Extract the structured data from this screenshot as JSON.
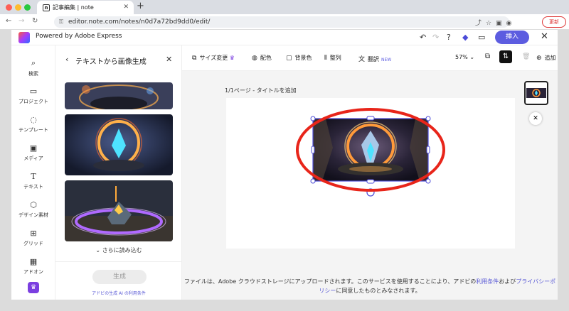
{
  "browser": {
    "tab_title": "記事編集 | note",
    "tab_icon_letter": "n",
    "url": "editor.note.com/notes/n0d7a72bd9dd0/edit/",
    "update_label": "更新"
  },
  "app": {
    "brand": "Powered by Adobe Express",
    "insert_label": "挿入"
  },
  "rail": [
    {
      "label": "検索",
      "icon": "search-icon"
    },
    {
      "label": "プロジェクト",
      "icon": "folder-icon"
    },
    {
      "label": "テンプレート",
      "icon": "template-icon"
    },
    {
      "label": "メディア",
      "icon": "media-icon"
    },
    {
      "label": "テキスト",
      "icon": "text-icon"
    },
    {
      "label": "デザイン素材",
      "icon": "design-icon"
    },
    {
      "label": "グリッド",
      "icon": "grid-icon"
    },
    {
      "label": "アドオン",
      "icon": "addon-icon"
    }
  ],
  "panel": {
    "title": "テキストから画像生成",
    "more": "さらに読み込む",
    "generate": "生成",
    "terms_link": "アドビの生成 AI の利用条件"
  },
  "toolbar": {
    "resize": "サイズ変更",
    "color": "配色",
    "background": "背景色",
    "align": "整列",
    "translate": "翻訳",
    "new_badge": "NEW",
    "zoom": "57%",
    "add": "追加"
  },
  "canvas": {
    "page_label": "1/1ページ - タイトルを追加",
    "footer_pre": "ファイルは、Adobe クラウドストレージにアップロードされます。このサービスを使用することにより、アドビの",
    "footer_terms": "利用条件",
    "footer_mid": "および",
    "footer_privacy": "プライバシーポリシー",
    "footer_post": "に同意したものとみなされます。"
  },
  "colors": {
    "accent": "#5c5ce0",
    "highlight_ellipse": "#e8251a",
    "selection": "#4b4bd8"
  }
}
